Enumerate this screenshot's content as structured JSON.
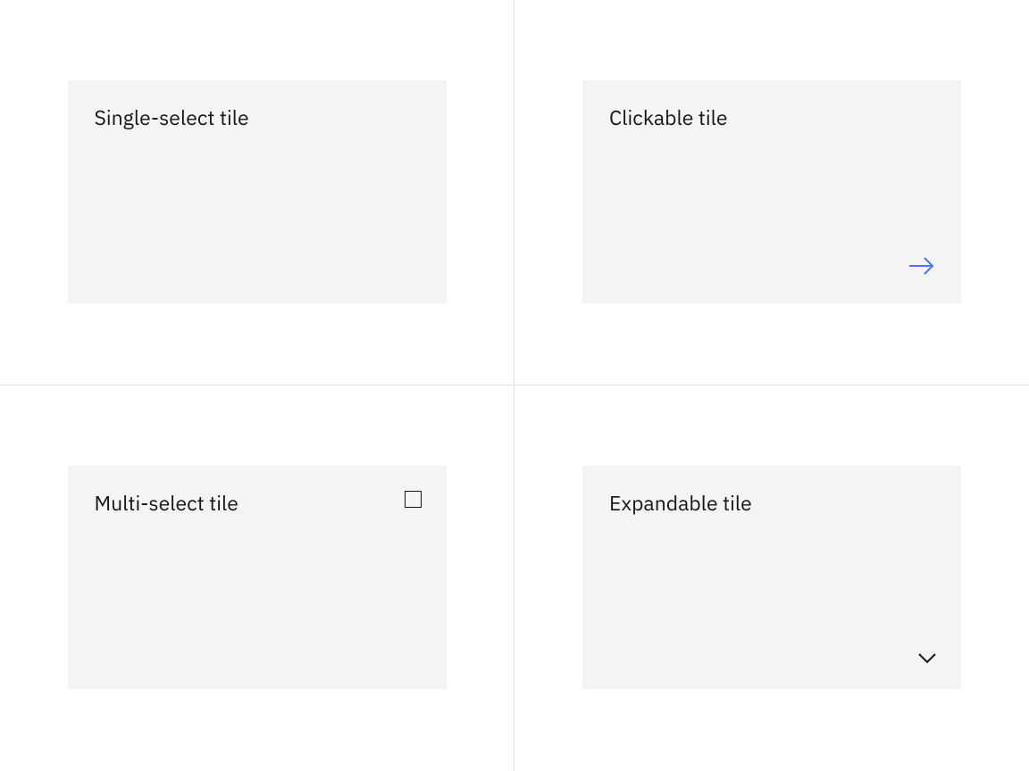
{
  "tiles": {
    "single_select": {
      "title": "Single-select tile"
    },
    "clickable": {
      "title": "Clickable tile"
    },
    "multi_select": {
      "title": "Multi-select tile"
    },
    "expandable": {
      "title": "Expandable tile"
    }
  },
  "colors": {
    "tile_bg": "#f4f4f4",
    "text": "#161616",
    "accent": "#4a74f9",
    "divider": "#e0e0e0"
  },
  "icons": {
    "arrow": "arrow-right-icon",
    "chevron": "chevron-down-icon",
    "checkbox": "checkbox-unchecked-icon"
  }
}
